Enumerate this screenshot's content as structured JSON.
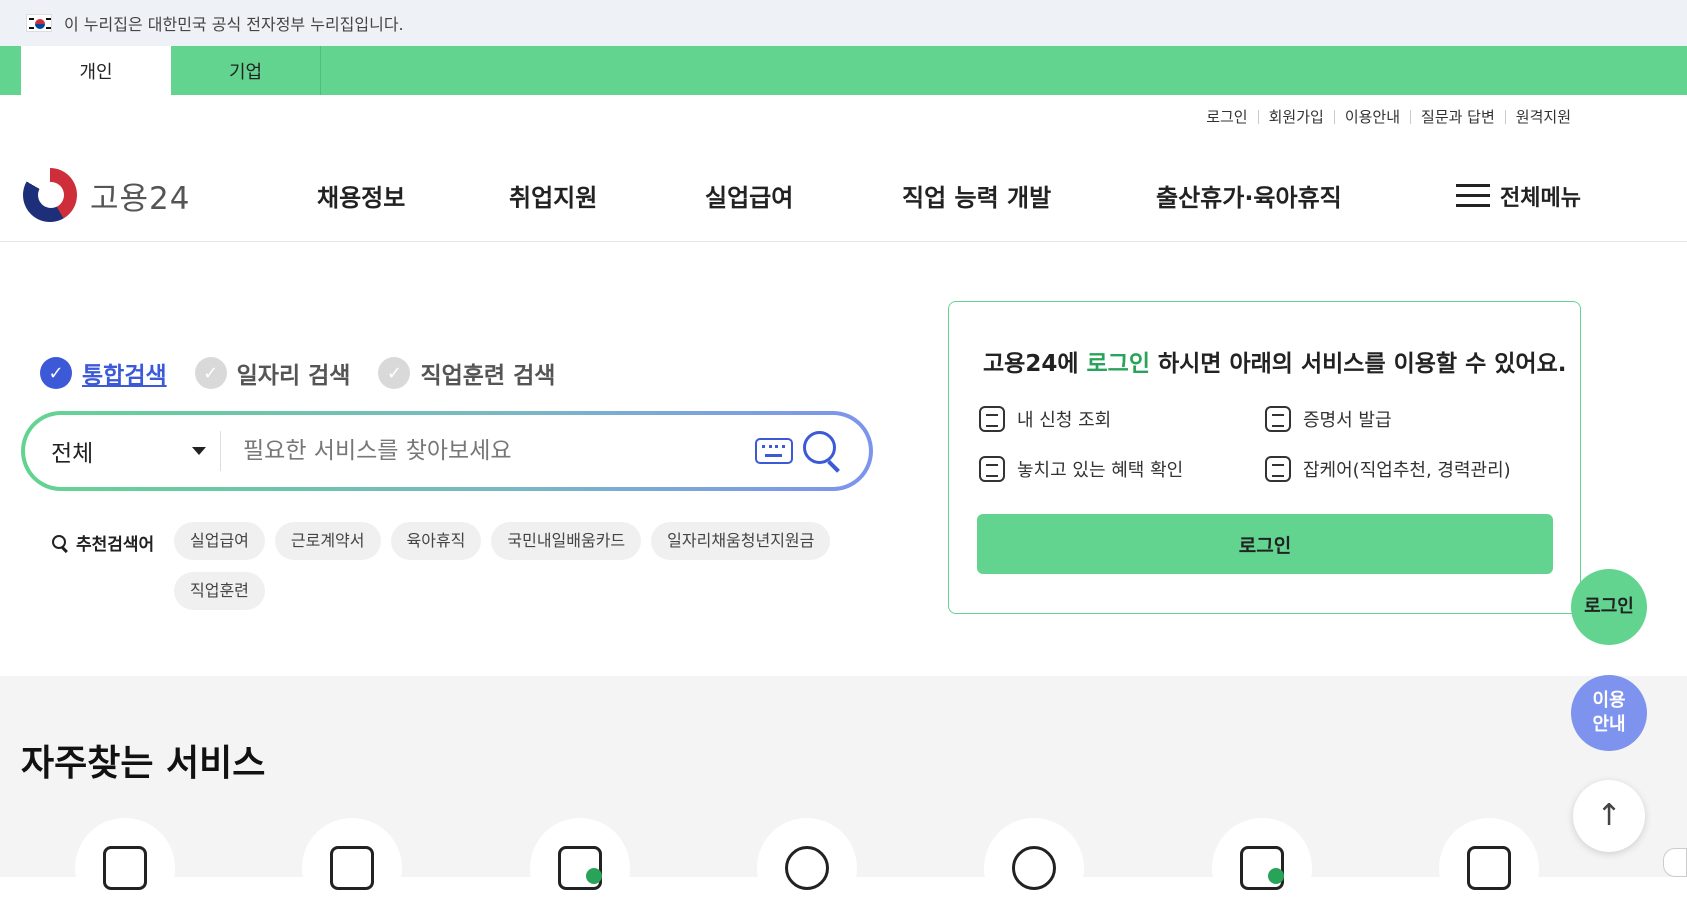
{
  "gov_banner": {
    "text": "이 누리집은 대한민국 공식 전자정부 누리집입니다."
  },
  "tabs": [
    {
      "label": "개인"
    },
    {
      "label": "기업"
    }
  ],
  "util_links": [
    "로그인",
    "회원가입",
    "이용안내",
    "질문과 답변",
    "원격지원"
  ],
  "logo": {
    "text": "고용24"
  },
  "gnb": [
    "채용정보",
    "취업지원",
    "실업급여",
    "직업 능력 개발",
    "출산휴가·육아휴직"
  ],
  "all_menu": {
    "label": "전체메뉴"
  },
  "search": {
    "types": [
      "통합검색",
      "일자리 검색",
      "직업훈련 검색"
    ],
    "scope_value": "전체",
    "placeholder": "필요한 서비스를 찾아보세요"
  },
  "recommend": {
    "title": "추천검색어",
    "keywords": [
      "실업급여",
      "근로계약서",
      "육아휴직",
      "국민내일배움카드",
      "일자리채움청년지원금",
      "직업훈련"
    ]
  },
  "login_card": {
    "title_pre": "고용24에 ",
    "title_link": "로그인",
    "title_post": " 하시면 아래의 서비스를 이용할 수 있어요.",
    "services": [
      "내 신청 조회",
      "증명서 발급",
      "놓치고 있는 혜택 확인",
      "잡케어(직업추천, 경력관리)"
    ],
    "button": "로그인"
  },
  "floating": {
    "login": "로그인",
    "guide_line1": "이용",
    "guide_line2": "안내",
    "top": "↑"
  },
  "frequent": {
    "title": "자주찾는 서비스"
  },
  "colors": {
    "brand_green": "#62d490",
    "accent_blue": "#3c5ad8",
    "periwinkle": "#7d93ee"
  }
}
